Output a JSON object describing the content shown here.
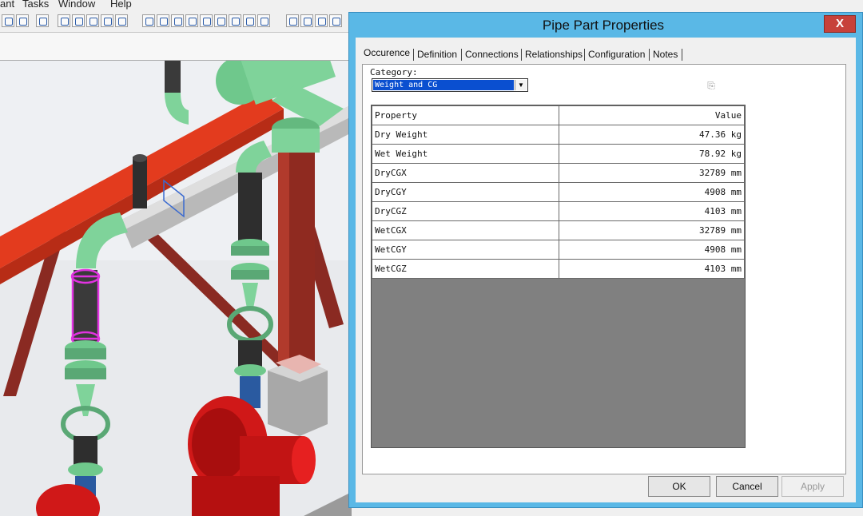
{
  "menubar": {
    "items": [
      "ant",
      "Tasks",
      "Window",
      "Help"
    ]
  },
  "dialog": {
    "title": "Pipe Part Properties",
    "close_label": "X",
    "tabs": [
      "Occurence",
      "Definition",
      "Connections",
      "Relationships",
      "Configuration",
      "Notes"
    ],
    "category_label": "Category:",
    "category_value": "Weight and CG",
    "table": {
      "headers": [
        "Property",
        "Value"
      ],
      "rows": [
        [
          "Dry Weight",
          "47.36 kg"
        ],
        [
          "Wet Weight",
          "78.92 kg"
        ],
        [
          "DryCGX",
          "32789 mm"
        ],
        [
          "DryCGY",
          "4908 mm"
        ],
        [
          "DryCGZ",
          "4103 mm"
        ],
        [
          "WetCGX",
          "32789 mm"
        ],
        [
          "WetCGY",
          "4908 mm"
        ],
        [
          "WetCGZ",
          "4103 mm"
        ]
      ]
    },
    "buttons": {
      "ok": "OK",
      "cancel": "Cancel",
      "apply": "Apply"
    }
  },
  "colors": {
    "titlebar": "#5ab8e6",
    "close": "#c7413a",
    "selection": "#0a4fd0",
    "pipe_green": "#7fd39a",
    "steel_red": "#e03a1e"
  }
}
